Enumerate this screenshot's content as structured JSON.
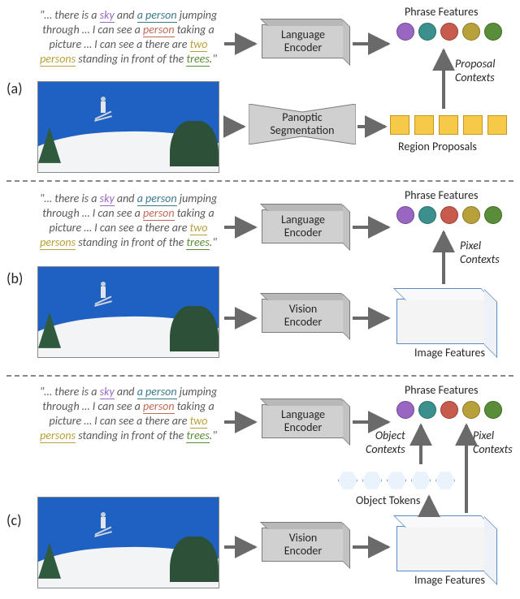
{
  "caption": {
    "pre": "\"… there is a ",
    "sky": "sky",
    "mid1": " and ",
    "a_person": "a person",
    "mid2": " jumping through … I can see a ",
    "person": "person",
    "mid3": " taking a picture … I can see a there are ",
    "two_persons": "two persons",
    "mid4": " standing in front of the ",
    "trees": "trees",
    "post": ".\""
  },
  "boxes": {
    "language_encoder": "Language\nEncoder",
    "panoptic": "Panoptic\nSegmentation",
    "vision_encoder": "Vision\nEncoder"
  },
  "labels": {
    "phrase_features": "Phrase Features",
    "proposal_contexts": "Proposal\nContexts",
    "region_proposals": "Region Proposals",
    "pixel_contexts": "Pixel\nContexts",
    "image_features": "Image Features",
    "object_contexts": "Object\nContexts",
    "object_tokens": "Object Tokens"
  },
  "letters": {
    "a": "(a)",
    "b": "(b)",
    "c": "(c)"
  }
}
